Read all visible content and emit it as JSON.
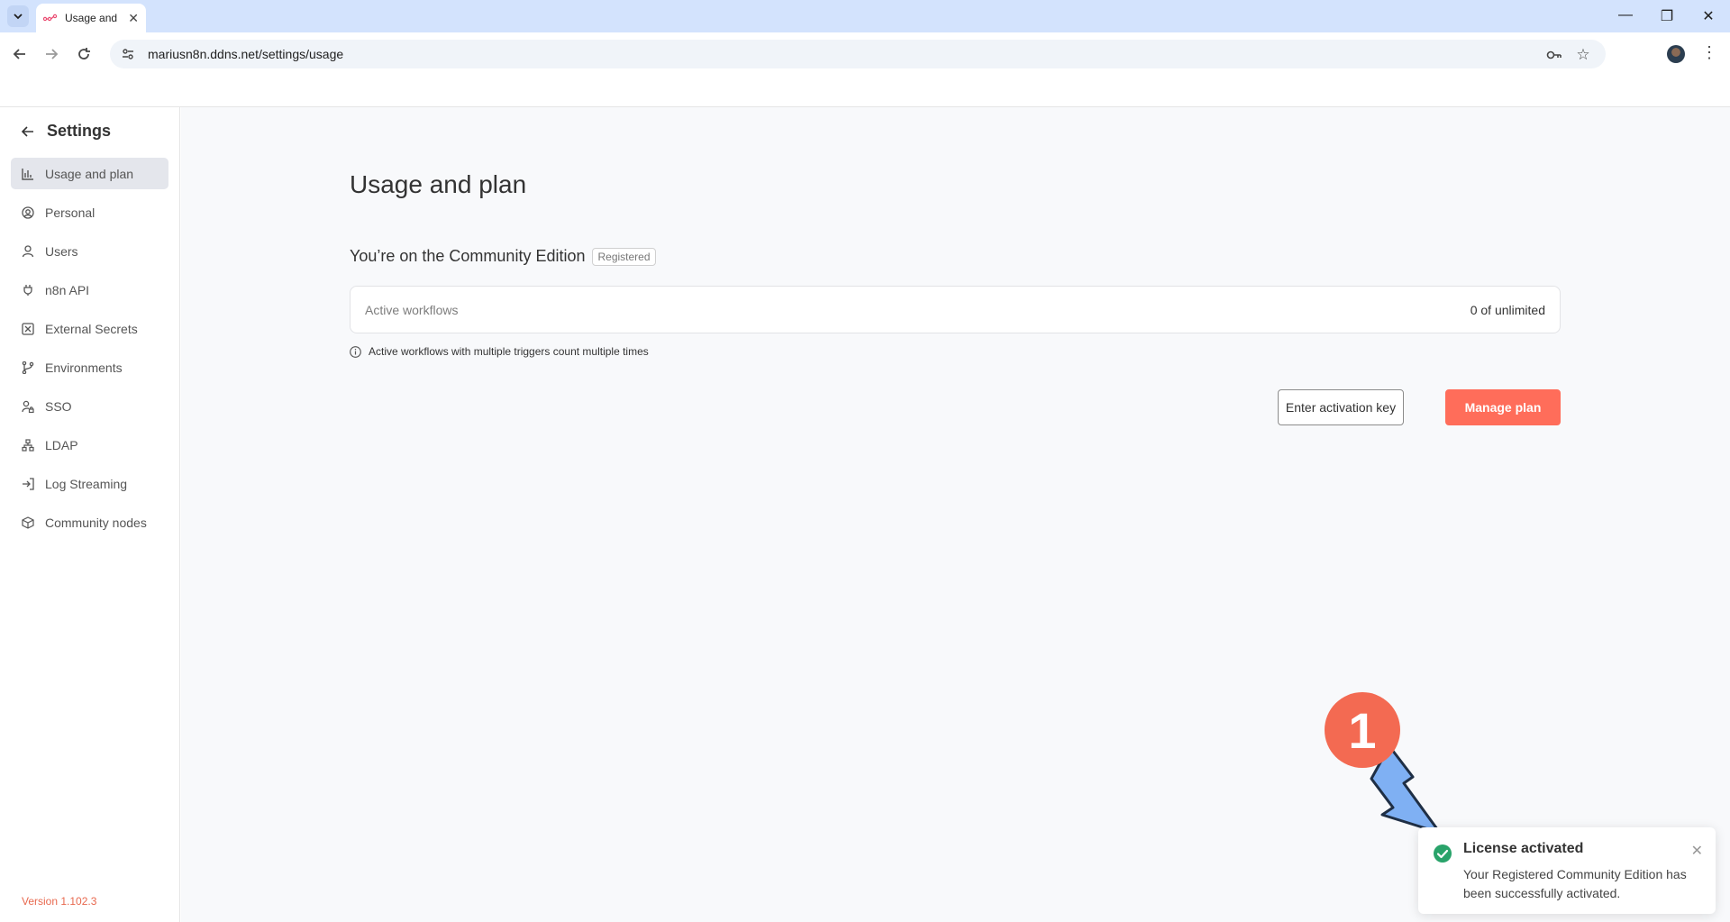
{
  "browser": {
    "tab_title": "Usage and plan",
    "url": "mariusn8n.ddns.net/settings/usage"
  },
  "sidebar": {
    "title": "Settings",
    "items": [
      {
        "label": "Usage and plan",
        "icon": "bar-chart-icon",
        "active": true
      },
      {
        "label": "Personal",
        "icon": "user-circle-icon"
      },
      {
        "label": "Users",
        "icon": "user-icon"
      },
      {
        "label": "n8n API",
        "icon": "plug-icon"
      },
      {
        "label": "External Secrets",
        "icon": "vault-icon"
      },
      {
        "label": "Environments",
        "icon": "git-branch-icon"
      },
      {
        "label": "SSO",
        "icon": "user-lock-icon"
      },
      {
        "label": "LDAP",
        "icon": "network-icon"
      },
      {
        "label": "Log Streaming",
        "icon": "sign-in-icon"
      },
      {
        "label": "Community nodes",
        "icon": "cube-icon"
      }
    ],
    "version": "Version 1.102.3"
  },
  "main": {
    "title": "Usage and plan",
    "plan_text": "You’re on the Community Edition",
    "plan_badge": "Registered",
    "usage": {
      "label": "Active workflows",
      "value": "0 of unlimited"
    },
    "hint": "Active workflows with multiple triggers count multiple times",
    "enter_key_label": "Enter activation key",
    "manage_plan_label": "Manage plan"
  },
  "toast": {
    "title": "License activated",
    "message": "Your Registered Community Edition has been successfully activated."
  },
  "annotation": {
    "step": "1"
  },
  "colors": {
    "primary": "#ff6d5a",
    "success": "#29a36a",
    "annotation_arrow": "#7fb0f3"
  }
}
